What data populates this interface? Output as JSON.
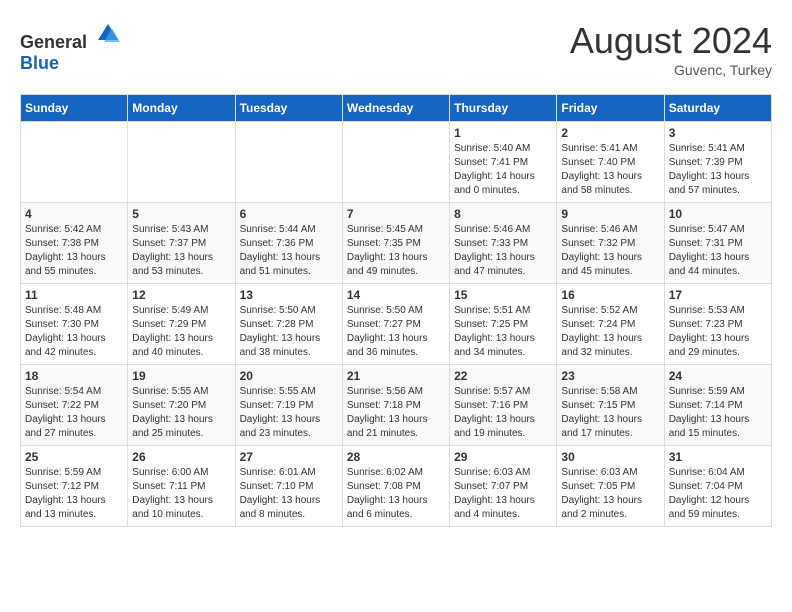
{
  "header": {
    "logo_general": "General",
    "logo_blue": "Blue",
    "month_year": "August 2024",
    "location": "Guvenc, Turkey"
  },
  "weekdays": [
    "Sunday",
    "Monday",
    "Tuesday",
    "Wednesday",
    "Thursday",
    "Friday",
    "Saturday"
  ],
  "weeks": [
    [
      {
        "day": "",
        "info": ""
      },
      {
        "day": "",
        "info": ""
      },
      {
        "day": "",
        "info": ""
      },
      {
        "day": "",
        "info": ""
      },
      {
        "day": "1",
        "info": "Sunrise: 5:40 AM\nSunset: 7:41 PM\nDaylight: 14 hours\nand 0 minutes."
      },
      {
        "day": "2",
        "info": "Sunrise: 5:41 AM\nSunset: 7:40 PM\nDaylight: 13 hours\nand 58 minutes."
      },
      {
        "day": "3",
        "info": "Sunrise: 5:41 AM\nSunset: 7:39 PM\nDaylight: 13 hours\nand 57 minutes."
      }
    ],
    [
      {
        "day": "4",
        "info": "Sunrise: 5:42 AM\nSunset: 7:38 PM\nDaylight: 13 hours\nand 55 minutes."
      },
      {
        "day": "5",
        "info": "Sunrise: 5:43 AM\nSunset: 7:37 PM\nDaylight: 13 hours\nand 53 minutes."
      },
      {
        "day": "6",
        "info": "Sunrise: 5:44 AM\nSunset: 7:36 PM\nDaylight: 13 hours\nand 51 minutes."
      },
      {
        "day": "7",
        "info": "Sunrise: 5:45 AM\nSunset: 7:35 PM\nDaylight: 13 hours\nand 49 minutes."
      },
      {
        "day": "8",
        "info": "Sunrise: 5:46 AM\nSunset: 7:33 PM\nDaylight: 13 hours\nand 47 minutes."
      },
      {
        "day": "9",
        "info": "Sunrise: 5:46 AM\nSunset: 7:32 PM\nDaylight: 13 hours\nand 45 minutes."
      },
      {
        "day": "10",
        "info": "Sunrise: 5:47 AM\nSunset: 7:31 PM\nDaylight: 13 hours\nand 44 minutes."
      }
    ],
    [
      {
        "day": "11",
        "info": "Sunrise: 5:48 AM\nSunset: 7:30 PM\nDaylight: 13 hours\nand 42 minutes."
      },
      {
        "day": "12",
        "info": "Sunrise: 5:49 AM\nSunset: 7:29 PM\nDaylight: 13 hours\nand 40 minutes."
      },
      {
        "day": "13",
        "info": "Sunrise: 5:50 AM\nSunset: 7:28 PM\nDaylight: 13 hours\nand 38 minutes."
      },
      {
        "day": "14",
        "info": "Sunrise: 5:50 AM\nSunset: 7:27 PM\nDaylight: 13 hours\nand 36 minutes."
      },
      {
        "day": "15",
        "info": "Sunrise: 5:51 AM\nSunset: 7:25 PM\nDaylight: 13 hours\nand 34 minutes."
      },
      {
        "day": "16",
        "info": "Sunrise: 5:52 AM\nSunset: 7:24 PM\nDaylight: 13 hours\nand 32 minutes."
      },
      {
        "day": "17",
        "info": "Sunrise: 5:53 AM\nSunset: 7:23 PM\nDaylight: 13 hours\nand 29 minutes."
      }
    ],
    [
      {
        "day": "18",
        "info": "Sunrise: 5:54 AM\nSunset: 7:22 PM\nDaylight: 13 hours\nand 27 minutes."
      },
      {
        "day": "19",
        "info": "Sunrise: 5:55 AM\nSunset: 7:20 PM\nDaylight: 13 hours\nand 25 minutes."
      },
      {
        "day": "20",
        "info": "Sunrise: 5:55 AM\nSunset: 7:19 PM\nDaylight: 13 hours\nand 23 minutes."
      },
      {
        "day": "21",
        "info": "Sunrise: 5:56 AM\nSunset: 7:18 PM\nDaylight: 13 hours\nand 21 minutes."
      },
      {
        "day": "22",
        "info": "Sunrise: 5:57 AM\nSunset: 7:16 PM\nDaylight: 13 hours\nand 19 minutes."
      },
      {
        "day": "23",
        "info": "Sunrise: 5:58 AM\nSunset: 7:15 PM\nDaylight: 13 hours\nand 17 minutes."
      },
      {
        "day": "24",
        "info": "Sunrise: 5:59 AM\nSunset: 7:14 PM\nDaylight: 13 hours\nand 15 minutes."
      }
    ],
    [
      {
        "day": "25",
        "info": "Sunrise: 5:59 AM\nSunset: 7:12 PM\nDaylight: 13 hours\nand 13 minutes."
      },
      {
        "day": "26",
        "info": "Sunrise: 6:00 AM\nSunset: 7:11 PM\nDaylight: 13 hours\nand 10 minutes."
      },
      {
        "day": "27",
        "info": "Sunrise: 6:01 AM\nSunset: 7:10 PM\nDaylight: 13 hours\nand 8 minutes."
      },
      {
        "day": "28",
        "info": "Sunrise: 6:02 AM\nSunset: 7:08 PM\nDaylight: 13 hours\nand 6 minutes."
      },
      {
        "day": "29",
        "info": "Sunrise: 6:03 AM\nSunset: 7:07 PM\nDaylight: 13 hours\nand 4 minutes."
      },
      {
        "day": "30",
        "info": "Sunrise: 6:03 AM\nSunset: 7:05 PM\nDaylight: 13 hours\nand 2 minutes."
      },
      {
        "day": "31",
        "info": "Sunrise: 6:04 AM\nSunset: 7:04 PM\nDaylight: 12 hours\nand 59 minutes."
      }
    ]
  ]
}
